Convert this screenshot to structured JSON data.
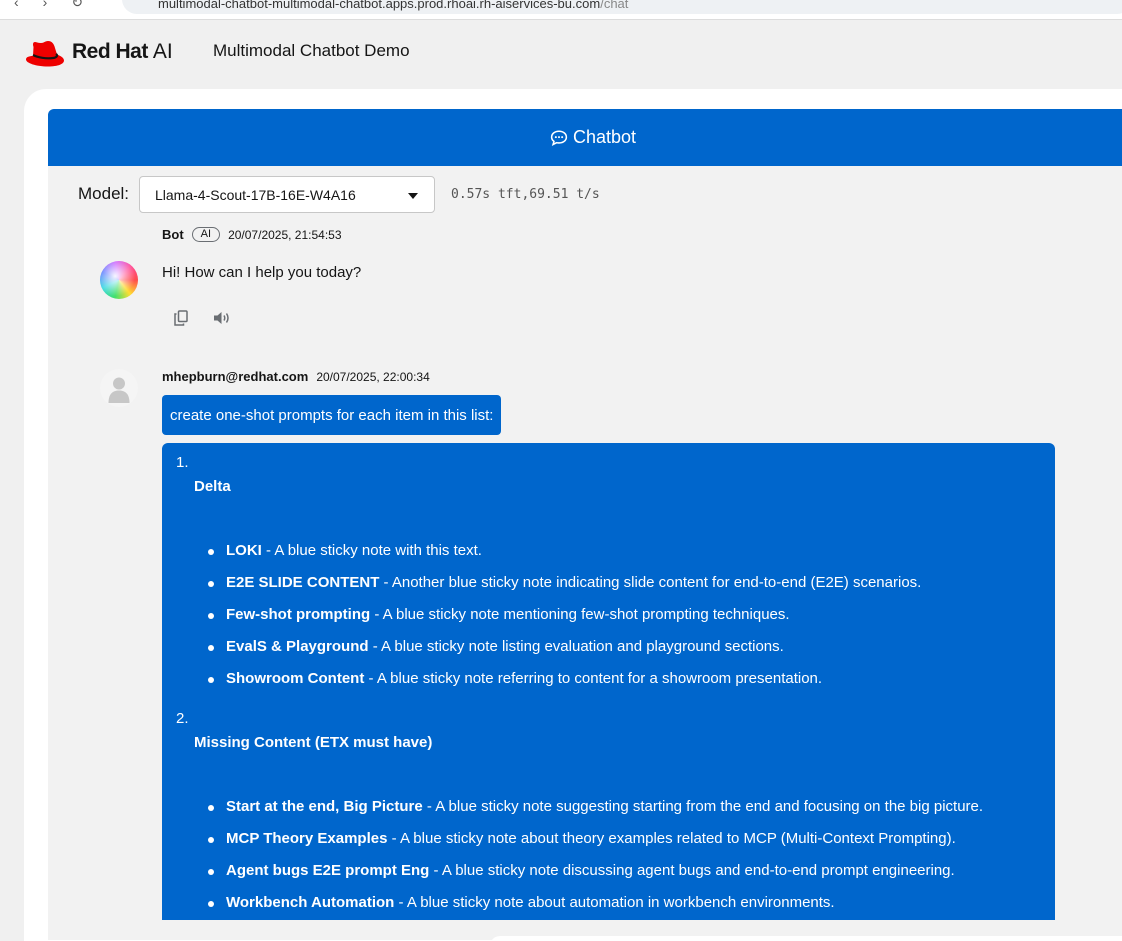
{
  "browser": {
    "url_host": "multimodal-chatbot-multimodal-chatbot.apps.prod.rhoai.rh-aiservices-bu.com",
    "url_path": "/chat"
  },
  "brand": {
    "name": "Red Hat",
    "suffix": "AI",
    "app_title": "Multimodal Chatbot Demo"
  },
  "chat": {
    "header_title": "Chatbot",
    "model_label": "Model:",
    "model_value": "Llama-4-Scout-17B-16E-W4A16",
    "perf": "0.57s tft,69.51 t/s"
  },
  "messages": {
    "bot": {
      "sender": "Bot",
      "badge": "AI",
      "timestamp": "20/07/2025, 21:54:53",
      "text": "Hi! How can I help you today?"
    },
    "user": {
      "sender": "mhepburn@redhat.com",
      "timestamp": "20/07/2025, 22:00:34",
      "text": "create one-shot prompts for each item in this list:"
    }
  },
  "response": {
    "sections": [
      {
        "number": "1.",
        "title": "Delta",
        "items": [
          {
            "bold": "LOKI",
            "desc": " - A blue sticky note with this text."
          },
          {
            "bold": "E2E SLIDE CONTENT",
            "desc": " - Another blue sticky note indicating slide content for end-to-end (E2E) scenarios."
          },
          {
            "bold": "Few-shot prompting",
            "desc": " - A blue sticky note mentioning few-shot prompting techniques."
          },
          {
            "bold": "EvalS & Playground",
            "desc": " - A blue sticky note listing evaluation and playground sections."
          },
          {
            "bold": "Showroom Content",
            "desc": " - A blue sticky note referring to content for a showroom presentation."
          }
        ]
      },
      {
        "number": "2.",
        "title": "Missing Content (ETX must have)",
        "items": [
          {
            "bold": "Start at the end, Big Picture",
            "desc": " - A blue sticky note suggesting starting from the end and focusing on the big picture."
          },
          {
            "bold": "MCP Theory Examples",
            "desc": " - A blue sticky note about theory examples related to MCP (Multi-Context Prompting)."
          },
          {
            "bold": "Agent bugs E2E prompt Eng",
            "desc": " - A blue sticky note discussing agent bugs and end-to-end prompt engineering."
          },
          {
            "bold": "Workbench Automation",
            "desc": " - A blue sticky note about automation in workbench environments."
          }
        ]
      }
    ]
  },
  "colors": {
    "accent": "#0066cc",
    "brand_red": "#ee0000",
    "panel_bg": "#f2f2f2"
  },
  "icons": [
    "redhat-fedora-logo",
    "chat-bubble-icon",
    "caret-down-icon",
    "copy-icon",
    "speaker-icon",
    "user-avatar-icon"
  ]
}
